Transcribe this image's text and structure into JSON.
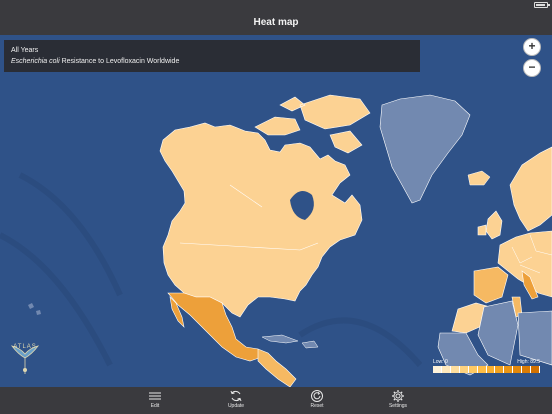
{
  "nav": {
    "title": "Heat map"
  },
  "info": {
    "line1": "All Years",
    "organism": "Escherichia coli",
    "line2_rest": " Resistance to Levofloxacin Worldwide"
  },
  "zoom": {
    "in": "+",
    "out": "−"
  },
  "logo": {
    "text": "ATLAS"
  },
  "legend": {
    "low": "Low: 0",
    "high": "High: 89.5",
    "colors": [
      "#fff3da",
      "#ffe9bd",
      "#ffdf9f",
      "#ffd37f",
      "#ffc962",
      "#ffbd45",
      "#f9b030",
      "#f2a21f",
      "#eb9513",
      "#e3880a",
      "#db7c04",
      "#d27100"
    ]
  },
  "map_colors": {
    "ocean": "#2f5288",
    "ocean_dark": "#284675",
    "no_data": "#7289b0",
    "light": "#fcd293",
    "medium": "#f6b962",
    "dark": "#eda03a",
    "borders": "#ffffff"
  },
  "tabs": [
    {
      "label": "Edit",
      "icon": "menu-icon"
    },
    {
      "label": "Update",
      "icon": "refresh-icon"
    },
    {
      "label": "Reset",
      "icon": "reset-icon"
    },
    {
      "label": "Settings",
      "icon": "gear-icon"
    }
  ]
}
